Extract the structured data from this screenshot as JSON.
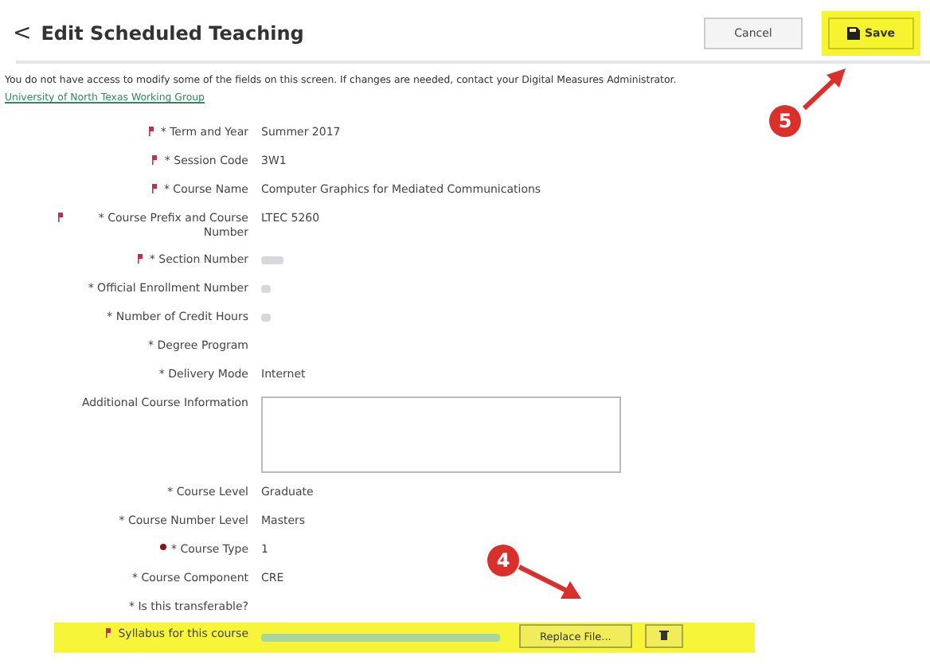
{
  "header": {
    "back_icon": "<",
    "title": "Edit Scheduled Teaching",
    "buttons": [
      {
        "label": "Cancel",
        "kind": "cancel",
        "highlighted": false
      },
      {
        "label": "Save",
        "kind": "save",
        "highlighted": true
      }
    ]
  },
  "notice": {
    "text": "You do not have access to modify some of the fields on this screen. If changes are needed, contact your Digital Measures Administrator.",
    "link": "University of North Texas Working Group"
  },
  "fields": [
    {
      "flagged": true,
      "dot_marked": false,
      "label": "* Term and Year",
      "kind": "text",
      "value": "Summer 2017"
    },
    {
      "flagged": true,
      "dot_marked": false,
      "label": "* Session Code",
      "kind": "text",
      "value": "3W1"
    },
    {
      "flagged": true,
      "dot_marked": false,
      "label": "* Course Name",
      "kind": "text",
      "value": "Computer Graphics for Mediated Communications"
    },
    {
      "flagged": true,
      "dot_marked": false,
      "label": "* Course Prefix and Course Number",
      "kind": "text",
      "value": "LTEC 5260"
    },
    {
      "flagged": true,
      "dot_marked": false,
      "label": "* Section Number",
      "kind": "redacted"
    },
    {
      "flagged": false,
      "dot_marked": false,
      "label": "* Official Enrollment Number",
      "kind": "redacted"
    },
    {
      "flagged": false,
      "dot_marked": false,
      "label": "* Number of Credit Hours",
      "kind": "redacted"
    },
    {
      "flagged": false,
      "dot_marked": false,
      "label": "* Degree Program",
      "kind": "empty"
    },
    {
      "flagged": false,
      "dot_marked": false,
      "label": "* Delivery Mode",
      "kind": "text",
      "value": "Internet"
    },
    {
      "flagged": false,
      "dot_marked": false,
      "label": "Additional Course Information",
      "kind": "textarea"
    },
    {
      "flagged": false,
      "dot_marked": false,
      "label": "* Course Level",
      "kind": "text",
      "value": "Graduate"
    },
    {
      "flagged": false,
      "dot_marked": false,
      "label": "* Course Number Level",
      "kind": "text",
      "value": "Masters"
    },
    {
      "flagged": false,
      "dot_marked": true,
      "label": "* Course Type",
      "kind": "text",
      "value": "1"
    },
    {
      "flagged": false,
      "dot_marked": false,
      "label": "* Course Component",
      "kind": "text",
      "value": "CRE"
    },
    {
      "flagged": false,
      "dot_marked": false,
      "label": "* Is this transferable?",
      "kind": "empty"
    },
    {
      "flagged": true,
      "dot_marked": false,
      "label": "Syllabus for this course",
      "kind": "file",
      "highlighted": true,
      "button": "Replace File..."
    }
  ],
  "annotations": [
    {
      "number": "5",
      "kind": "save"
    },
    {
      "number": "4",
      "kind": "file"
    }
  ]
}
